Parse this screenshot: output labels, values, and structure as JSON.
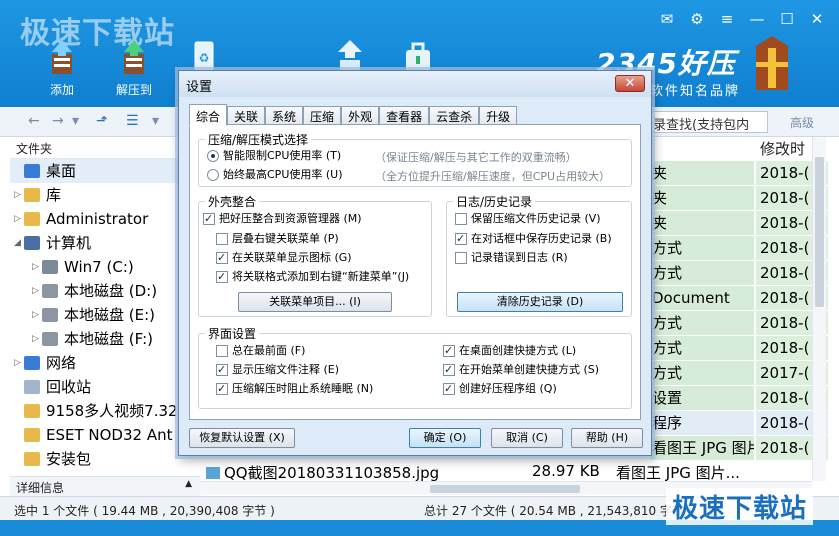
{
  "app": {
    "watermark": "极速下载站",
    "brand": "2345好压",
    "brand_sub": "软件知名品牌",
    "toolbar": [
      {
        "label": "添加"
      },
      {
        "label": "解压到"
      },
      {
        "label": ""
      },
      {
        "label": ""
      },
      {
        "label": ""
      }
    ],
    "search_placeholder": "录查找(支持包内",
    "advanced_label": "高级",
    "tree_header": "文件夹",
    "tree": [
      {
        "label": "桌面",
        "icon": "desktop-icon"
      },
      {
        "label": "库",
        "icon": "library-folder-icon"
      },
      {
        "label": "Administrator",
        "icon": "user-folder-icon"
      },
      {
        "label": "计算机",
        "icon": "computer-icon"
      },
      {
        "label": "Win7 (C:)",
        "icon": "system-drive-icon"
      },
      {
        "label": "本地磁盘 (D:)",
        "icon": "drive-icon"
      },
      {
        "label": "本地磁盘 (E:)",
        "icon": "drive-icon"
      },
      {
        "label": "本地磁盘 (F:)",
        "icon": "drive-icon"
      },
      {
        "label": "网络",
        "icon": "network-icon"
      },
      {
        "label": "回收站",
        "icon": "recycle-bin-icon"
      },
      {
        "label": "9158多人视频7.32",
        "icon": "folder-icon"
      },
      {
        "label": "ESET NOD32 Ant",
        "icon": "folder-icon"
      },
      {
        "label": "安装包",
        "icon": "folder-icon"
      }
    ],
    "detail_label": "详细信息",
    "column_modified": "修改时",
    "rows": [
      {
        "type": "夹",
        "date": "2018-("
      },
      {
        "type": "夹",
        "date": "2018-("
      },
      {
        "type": "夹",
        "date": "2018-("
      },
      {
        "type": "方式",
        "date": "2018-("
      },
      {
        "type": "方式",
        "date": "2018-("
      },
      {
        "type": "Document",
        "date": "2018-("
      },
      {
        "type": "方式",
        "date": "2018-("
      },
      {
        "type": "方式",
        "date": "2018-("
      },
      {
        "type": "方式",
        "date": "2017-("
      },
      {
        "type": "设置",
        "date": "2018-("
      },
      {
        "type": "程序",
        "date": "2018-("
      },
      {
        "type": "看图王 JPG 图片...",
        "date": "2018-("
      }
    ],
    "bottom_file": {
      "name": "QQ截图20180331103858.jpg",
      "size": "28.97 KB",
      "type": "看图王 JPG 图片..."
    },
    "status_left": "选中 1 个文件 ( 19.44 MB , 20,390,408 字节 )",
    "status_right": "总计 27 个文件 ( 20.54 MB , 21,543,810 字节 )"
  },
  "dialog": {
    "title": "设置",
    "close": "✕",
    "tabs": [
      "综合",
      "关联",
      "系统",
      "压缩",
      "外观",
      "查看器",
      "云查杀",
      "升级"
    ],
    "active_tab": "综合",
    "mode_group": {
      "title": "压缩/解压模式选择",
      "options": [
        {
          "label": "智能限制CPU使用率 (T)",
          "hint": "（保证压缩/解压与其它工作的双重流畅）",
          "selected": true
        },
        {
          "label": "始终最高CPU使用率 (U)",
          "hint": "（全方位提升压缩/解压速度，但CPU占用较大）",
          "selected": false
        }
      ]
    },
    "shell_group": {
      "title": "外壳整合",
      "options": [
        {
          "label": "把好压整合到资源管理器 (M)",
          "checked": true
        },
        {
          "label": "层叠右键关联菜单 (P)",
          "checked": false
        },
        {
          "label": "在关联菜单显示图标 (G)",
          "checked": true
        },
        {
          "label": "将关联格式添加到右键“新建菜单”(J)",
          "checked": true
        }
      ],
      "button": "关联菜单项目... (I)"
    },
    "history_group": {
      "title": "日志/历史记录",
      "options": [
        {
          "label": "保留压缩文件历史记录 (V)",
          "checked": false
        },
        {
          "label": "在对话框中保存历史记录 (B)",
          "checked": true
        },
        {
          "label": "记录错误到日志 (R)",
          "checked": false
        }
      ],
      "button": "清除历史记录 (D)"
    },
    "ui_group": {
      "title": "界面设置",
      "left": [
        {
          "label": "总在最前面 (F)",
          "checked": false
        },
        {
          "label": "显示压缩文件注释 (E)",
          "checked": true
        },
        {
          "label": "压缩解压时阻止系统睡眠 (N)",
          "checked": true
        }
      ],
      "right": [
        {
          "label": "在桌面创建快捷方式 (L)",
          "checked": true
        },
        {
          "label": "在开始菜单创建快捷方式 (S)",
          "checked": true
        },
        {
          "label": "创建好压程序组 (Q)",
          "checked": true
        }
      ]
    },
    "buttons": {
      "reset": "恢复默认设置 (X)",
      "ok": "确定 (O)",
      "cancel": "取消 (C)",
      "help": "帮助 (H)"
    }
  }
}
